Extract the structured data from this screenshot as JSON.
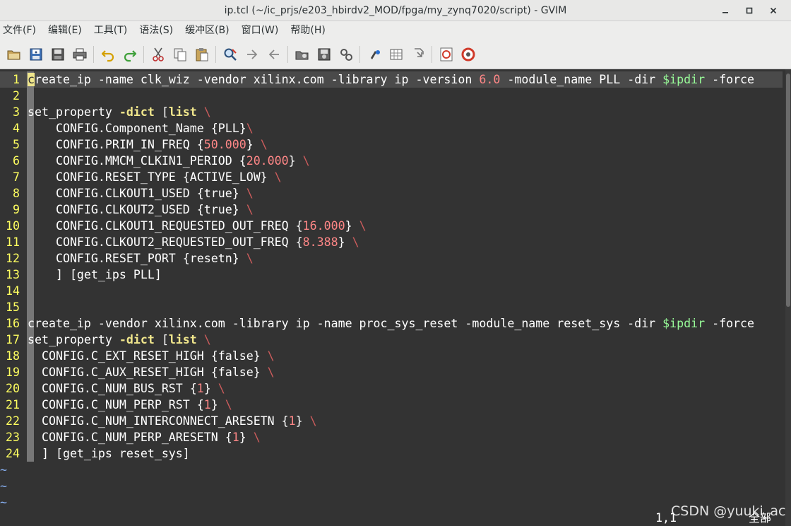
{
  "window": {
    "title": "ip.tcl (~/ic_prjs/e203_hbirdv2_MOD/fpga/my_zynq7020/script) - GVIM",
    "controls": [
      "minimize",
      "maximize",
      "close"
    ]
  },
  "menu": [
    "文件(F)",
    "编辑(E)",
    "工具(T)",
    "语法(S)",
    "缓冲区(B)",
    "窗口(W)",
    "帮助(H)"
  ],
  "toolbar": {
    "buttons": [
      "open",
      "save",
      "save-all",
      "print",
      "undo",
      "redo",
      "cut",
      "copy",
      "paste",
      "find-replace",
      "find-next",
      "find-previous",
      "load-session",
      "save-session",
      "run-script",
      "make",
      "build-tags",
      "jump-to-tag",
      "help",
      "find-help"
    ]
  },
  "editor": {
    "lines": [
      {
        "n": "1",
        "current": true,
        "tokens": [
          {
            "t": "c",
            "c": "cursor"
          },
          {
            "t": "reate_ip -name clk_wiz -vendor xilinx.com -library ip -version ",
            "c": ""
          },
          {
            "t": "6.0",
            "c": "num"
          },
          {
            "t": " -module_name PLL -dir ",
            "c": ""
          },
          {
            "t": "$ipdir",
            "c": "var"
          },
          {
            "t": " -force",
            "c": ""
          }
        ]
      },
      {
        "n": "2",
        "tokens": []
      },
      {
        "n": "3",
        "tokens": [
          {
            "t": "set_property ",
            "c": ""
          },
          {
            "t": "-dict",
            "c": "kw"
          },
          {
            "t": " [",
            "c": ""
          },
          {
            "t": "list",
            "c": "kw"
          },
          {
            "t": " ",
            "c": ""
          },
          {
            "t": "\\",
            "c": "bs"
          }
        ]
      },
      {
        "n": "4",
        "tokens": [
          {
            "t": "    CONFIG.Component_Name {PLL}",
            "c": ""
          },
          {
            "t": "\\",
            "c": "bs"
          }
        ]
      },
      {
        "n": "5",
        "tokens": [
          {
            "t": "    CONFIG.PRIM_IN_FREQ {",
            "c": ""
          },
          {
            "t": "50.000",
            "c": "num"
          },
          {
            "t": "} ",
            "c": ""
          },
          {
            "t": "\\",
            "c": "bs"
          }
        ]
      },
      {
        "n": "6",
        "tokens": [
          {
            "t": "    CONFIG.MMCM_CLKIN1_PERIOD {",
            "c": ""
          },
          {
            "t": "20.000",
            "c": "num"
          },
          {
            "t": "} ",
            "c": ""
          },
          {
            "t": "\\",
            "c": "bs"
          }
        ]
      },
      {
        "n": "7",
        "tokens": [
          {
            "t": "    CONFIG.RESET_TYPE {ACTIVE_LOW} ",
            "c": ""
          },
          {
            "t": "\\",
            "c": "bs"
          }
        ]
      },
      {
        "n": "8",
        "tokens": [
          {
            "t": "    CONFIG.CLKOUT1_USED {true} ",
            "c": ""
          },
          {
            "t": "\\",
            "c": "bs"
          }
        ]
      },
      {
        "n": "9",
        "tokens": [
          {
            "t": "    CONFIG.CLKOUT2_USED {true} ",
            "c": ""
          },
          {
            "t": "\\",
            "c": "bs"
          }
        ]
      },
      {
        "n": "10",
        "tokens": [
          {
            "t": "    CONFIG.CLKOUT1_REQUESTED_OUT_FREQ {",
            "c": ""
          },
          {
            "t": "16.000",
            "c": "num"
          },
          {
            "t": "} ",
            "c": ""
          },
          {
            "t": "\\",
            "c": "bs"
          }
        ]
      },
      {
        "n": "11",
        "tokens": [
          {
            "t": "    CONFIG.CLKOUT2_REQUESTED_OUT_FREQ {",
            "c": ""
          },
          {
            "t": "8.388",
            "c": "num"
          },
          {
            "t": "} ",
            "c": ""
          },
          {
            "t": "\\",
            "c": "bs"
          }
        ]
      },
      {
        "n": "12",
        "tokens": [
          {
            "t": "    CONFIG.RESET_PORT {resetn} ",
            "c": ""
          },
          {
            "t": "\\",
            "c": "bs"
          }
        ]
      },
      {
        "n": "13",
        "tokens": [
          {
            "t": "    ] [get_ips PLL]",
            "c": ""
          }
        ]
      },
      {
        "n": "14",
        "tokens": []
      },
      {
        "n": "15",
        "tokens": []
      },
      {
        "n": "16",
        "tokens": [
          {
            "t": "create_ip -vendor xilinx.com -library ip -name proc_sys_reset -module_name reset_sys -dir ",
            "c": ""
          },
          {
            "t": "$ipdir",
            "c": "var"
          },
          {
            "t": " -force",
            "c": ""
          }
        ]
      },
      {
        "n": "17",
        "tokens": [
          {
            "t": "set_property ",
            "c": ""
          },
          {
            "t": "-dict",
            "c": "kw"
          },
          {
            "t": " [",
            "c": ""
          },
          {
            "t": "list",
            "c": "kw"
          },
          {
            "t": " ",
            "c": ""
          },
          {
            "t": "\\",
            "c": "bs"
          }
        ]
      },
      {
        "n": "18",
        "tokens": [
          {
            "t": "  CONFIG.C_EXT_RESET_HIGH {false} ",
            "c": ""
          },
          {
            "t": "\\",
            "c": "bs"
          }
        ]
      },
      {
        "n": "19",
        "tokens": [
          {
            "t": "  CONFIG.C_AUX_RESET_HIGH {false} ",
            "c": ""
          },
          {
            "t": "\\",
            "c": "bs"
          }
        ]
      },
      {
        "n": "20",
        "tokens": [
          {
            "t": "  CONFIG.C_NUM_BUS_RST {",
            "c": ""
          },
          {
            "t": "1",
            "c": "num"
          },
          {
            "t": "} ",
            "c": ""
          },
          {
            "t": "\\",
            "c": "bs"
          }
        ]
      },
      {
        "n": "21",
        "tokens": [
          {
            "t": "  CONFIG.C_NUM_PERP_RST {",
            "c": ""
          },
          {
            "t": "1",
            "c": "num"
          },
          {
            "t": "} ",
            "c": ""
          },
          {
            "t": "\\",
            "c": "bs"
          }
        ]
      },
      {
        "n": "22",
        "tokens": [
          {
            "t": "  CONFIG.C_NUM_INTERCONNECT_ARESETN {",
            "c": ""
          },
          {
            "t": "1",
            "c": "num"
          },
          {
            "t": "} ",
            "c": ""
          },
          {
            "t": "\\",
            "c": "bs"
          }
        ]
      },
      {
        "n": "23",
        "tokens": [
          {
            "t": "  CONFIG.C_NUM_PERP_ARESETN {",
            "c": ""
          },
          {
            "t": "1",
            "c": "num"
          },
          {
            "t": "} ",
            "c": ""
          },
          {
            "t": "\\",
            "c": "bs"
          }
        ]
      },
      {
        "n": "24",
        "tokens": [
          {
            "t": "  ] [get_ips reset_sys]",
            "c": ""
          }
        ]
      }
    ],
    "tilde_lines": [
      "~",
      "~",
      "~"
    ]
  },
  "status": {
    "ruler": "1,1",
    "position": "全部"
  },
  "watermark": "CSDN @yuuki_ac",
  "colors": {
    "background": "#333333",
    "line_number": "#ffff60",
    "keyword": "#f0e68c",
    "number": "#ff8787",
    "backslash": "#cd5c5c",
    "variable": "#98fb98",
    "tilde": "#8ab4f8"
  }
}
